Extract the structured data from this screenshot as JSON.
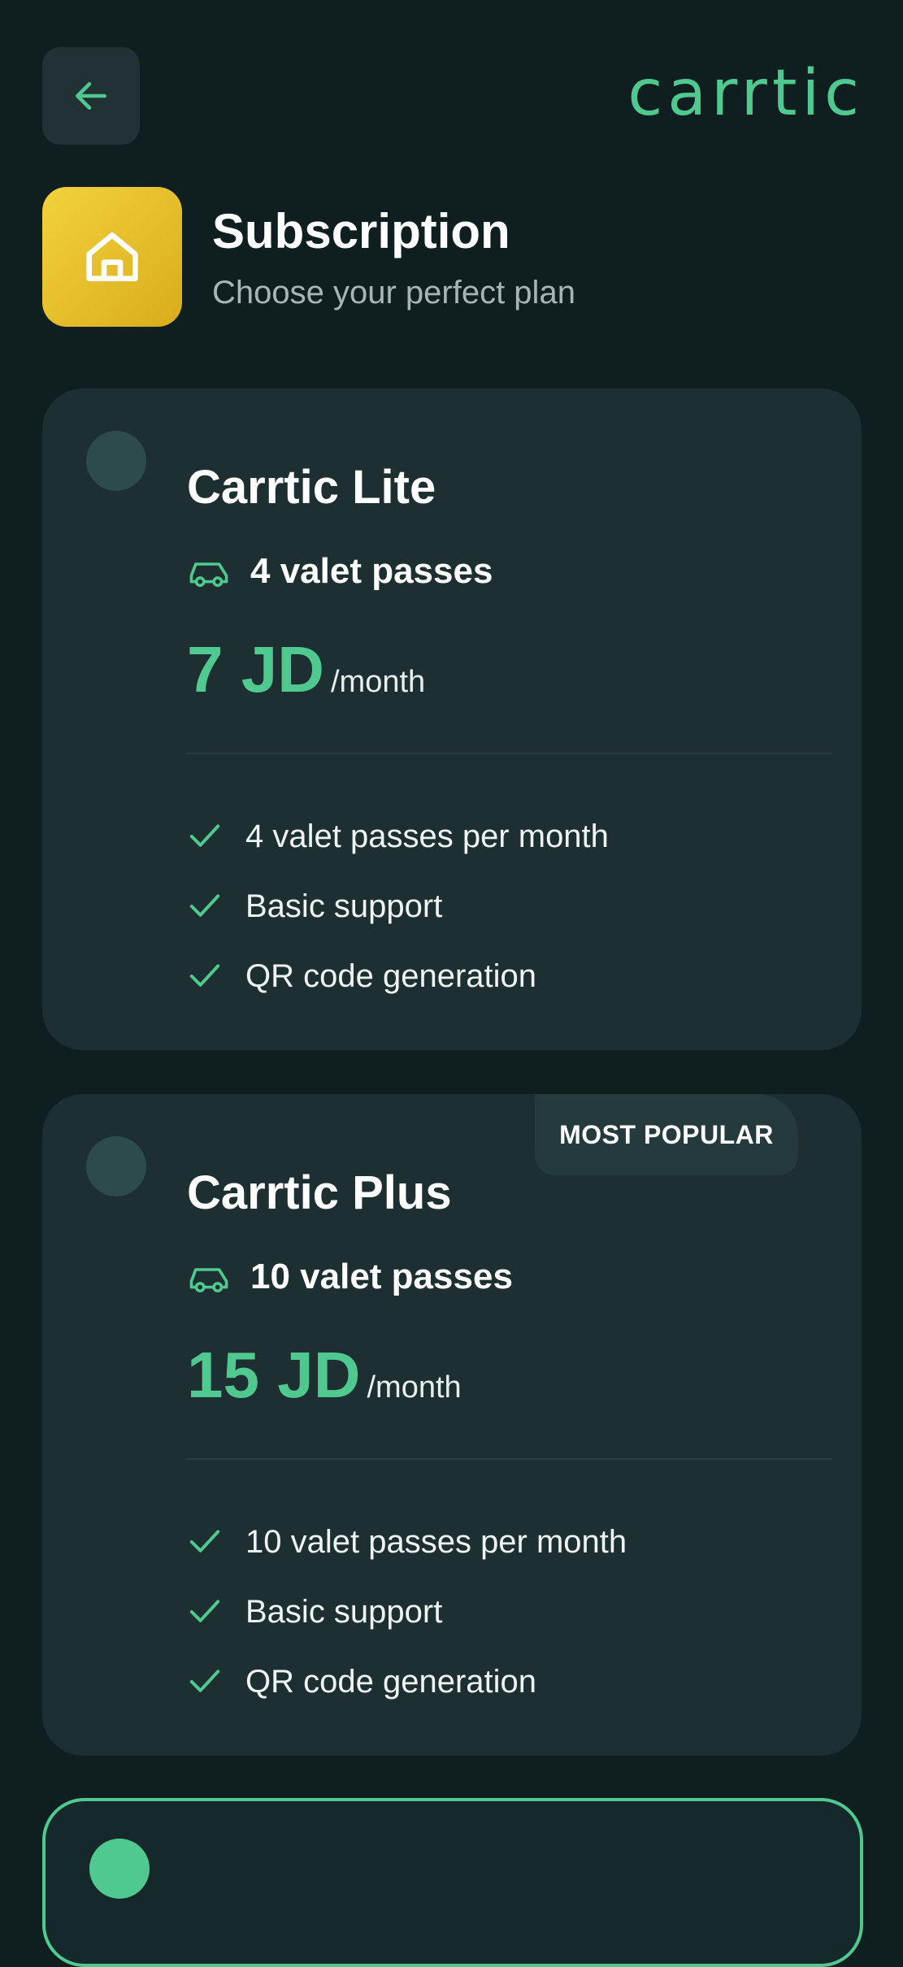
{
  "app": {
    "logo_text": "carrtic",
    "back_icon": "arrow-left-icon",
    "accent_color": "#4fc98f",
    "badge_color": "#f2c92e"
  },
  "header": {
    "title": "Subscription",
    "subtitle": "Choose your perfect plan",
    "icon": "house-icon"
  },
  "plans": [
    {
      "name": "Carrtic Lite",
      "passes_label": "4 valet passes",
      "price": "7 JD",
      "period": "/month",
      "badge": "",
      "selected": false,
      "features": [
        "4 valet passes per month",
        "Basic support",
        "QR code generation"
      ]
    },
    {
      "name": "Carrtic Plus",
      "passes_label": "10 valet passes",
      "price": "15 JD",
      "period": "/month",
      "badge": "MOST POPULAR",
      "selected": false,
      "features": [
        "10 valet passes per month",
        "Basic support",
        "QR code generation"
      ]
    },
    {
      "selected": true
    }
  ]
}
